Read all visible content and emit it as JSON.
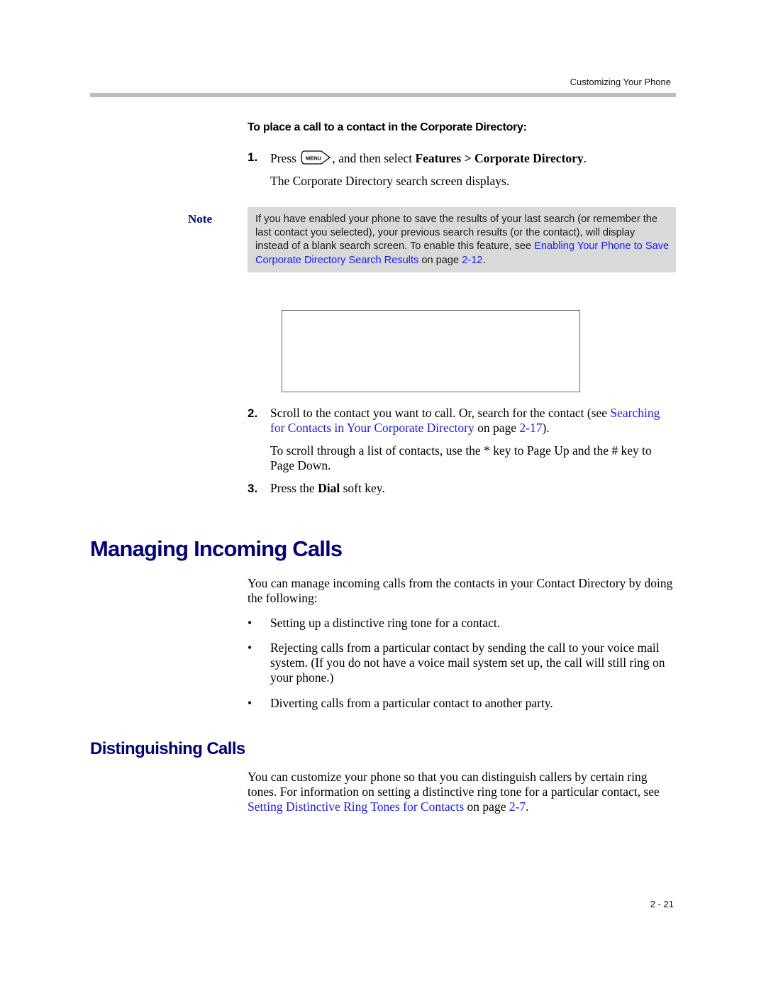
{
  "header": {
    "section_title": "Customizing Your Phone"
  },
  "procedure": {
    "title": "To place a call to a contact in the Corporate Directory:",
    "steps": [
      {
        "number": "1.",
        "pre": "Press",
        "key_icon": "menu-key",
        "key_label": "MENU",
        "mid": ", and then select ",
        "bold": "Features > Corporate Directory",
        "post": ".",
        "result": "The Corporate Directory search screen displays."
      },
      {
        "number": "2.",
        "text": "Scroll to the contact you want to call. Or, search for the contact (see ",
        "link": "Searching for Contacts in Your Corporate Directory",
        "page_pre": " on page ",
        "page_link": "2-17",
        "post": ").",
        "extra": "To scroll through a list of contacts, use the * key to Page Up and the # key to Page Down."
      },
      {
        "number": "3.",
        "pre": "Press the ",
        "bold": "Dial",
        "post": " soft key."
      }
    ]
  },
  "note": {
    "label": "Note",
    "text": "If you have enabled your phone to save the results of your last search (or remember the last contact you selected), your previous search results (or the contact), will display instead of a blank search screen. To enable this feature, see ",
    "link": "Enabling Your Phone to Save Corporate Directory Search Results",
    "page_pre": " on page ",
    "page_link": "2-12",
    "post": "."
  },
  "section_managing": {
    "heading": "Managing Incoming Calls",
    "intro": "You can manage incoming calls from the contacts in your Contact Directory by doing the following:",
    "bullets": [
      "Setting up a distinctive ring tone for a contact.",
      "Rejecting calls from a particular contact by sending the call to your voice mail system. (If you do not have a voice mail system set up, the call will still ring on your phone.)",
      "Diverting calls from a particular contact to another party."
    ],
    "bullet_char": "•"
  },
  "section_distinguishing": {
    "heading": "Distinguishing Calls",
    "text": "You can customize your phone so that you can distinguish callers by certain ring tones. For information on setting a distinctive ring tone for a particular contact, see ",
    "link": "Setting Distinctive Ring Tones for Contacts",
    "page_pre": " on page ",
    "page_link": "2-7",
    "post": "."
  },
  "footer": {
    "page_number": "2 - 21"
  }
}
